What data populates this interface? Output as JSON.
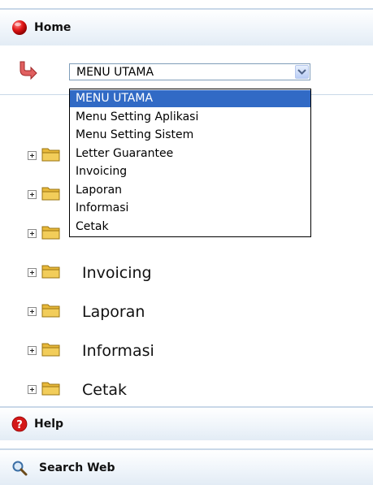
{
  "panels": {
    "home_label": "Home",
    "help_label": "Help",
    "search_label": "Search Web"
  },
  "menu_select": {
    "selected": "MENU UTAMA",
    "options": [
      "MENU UTAMA",
      "Menu Setting Aplikasi",
      "Menu Setting Sistem",
      "Letter Guarantee",
      "Invoicing",
      "Laporan",
      "Informasi",
      "Cetak"
    ]
  },
  "tree": {
    "items": [
      {
        "label": ""
      },
      {
        "label": ""
      },
      {
        "label": ""
      },
      {
        "label": "Invoicing"
      },
      {
        "label": "Laporan"
      },
      {
        "label": "Informasi"
      },
      {
        "label": "Cetak"
      }
    ]
  },
  "colors": {
    "selection": "#316ac5",
    "panel_border": "#c9d8e8",
    "home_icon": "#cc1111",
    "help_icon": "#cc1111",
    "folder": "#f2cd5a"
  },
  "icons": {
    "home": "red-ball-icon",
    "return": "return-arrow-icon",
    "help": "help-icon",
    "search": "magnifier-icon",
    "folder": "folder-icon",
    "expand": "plus-box-icon"
  }
}
